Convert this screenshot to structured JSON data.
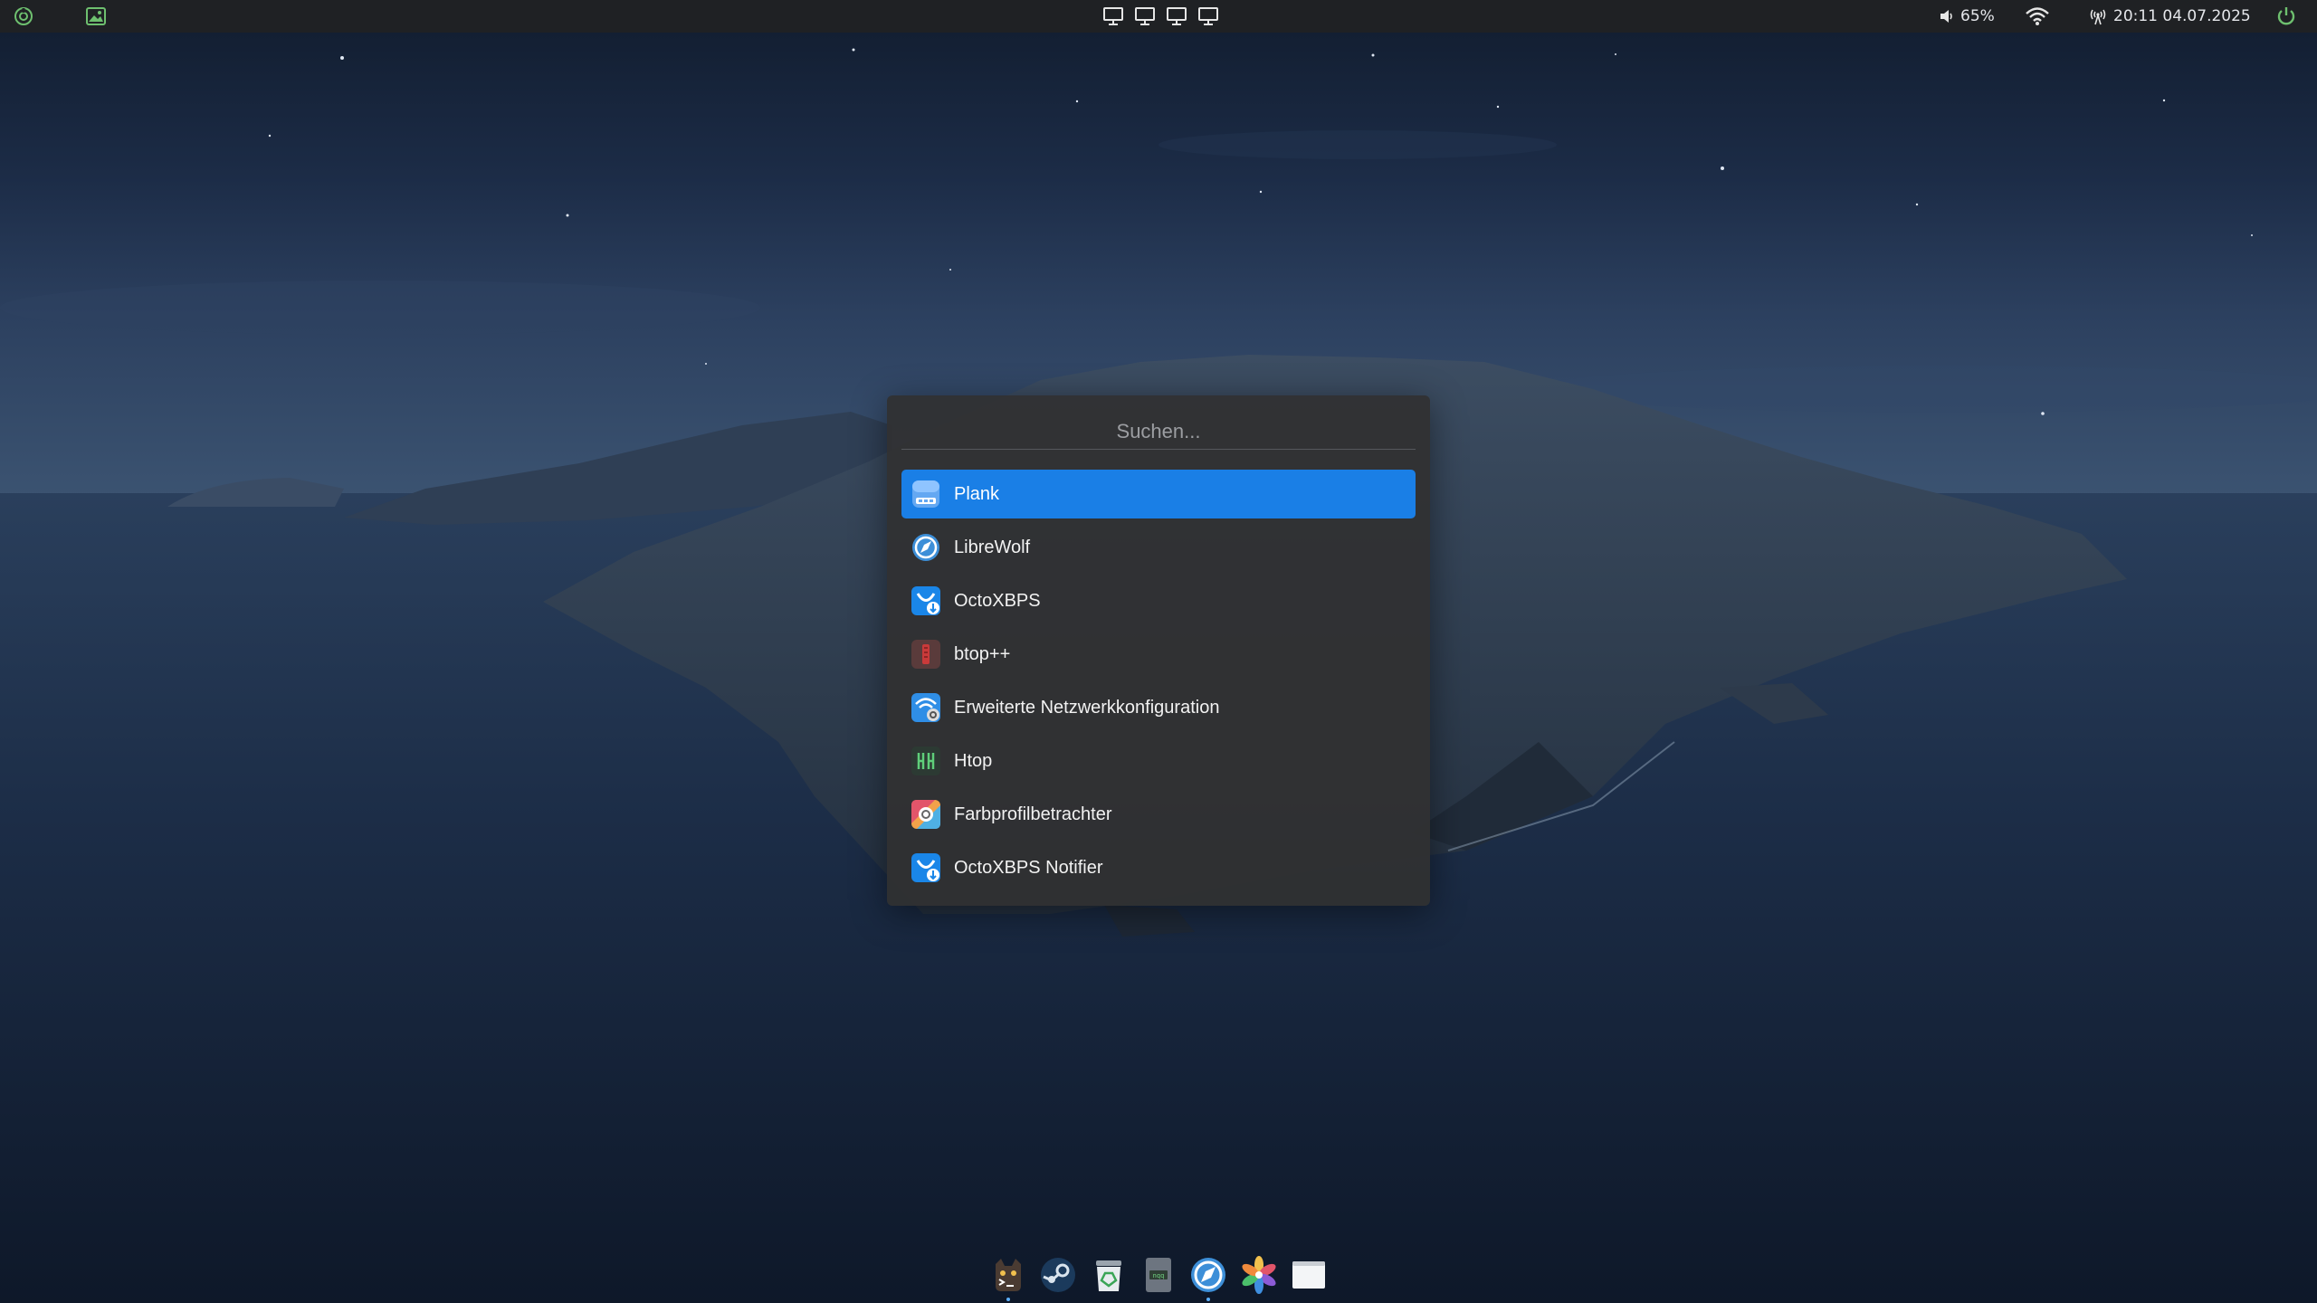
{
  "top_panel": {
    "left_icons": [
      "menu-icon",
      "image-viewer-icon"
    ],
    "workspaces": [
      "workspace-1",
      "workspace-2",
      "workspace-3",
      "workspace-4"
    ],
    "volume": {
      "icon": "volume-icon",
      "label": "65%"
    },
    "network": {
      "icon": "wifi-icon"
    },
    "clock": {
      "icon": "radio-antenna-icon",
      "label": "20:11 04.07.2025"
    },
    "power": {
      "icon": "power-icon"
    },
    "accent_color": "#6ec06f"
  },
  "launcher": {
    "search": {
      "placeholder": "Suchen...",
      "value": ""
    },
    "selected_index": 0,
    "selection_color": "#1a7fe6",
    "results": [
      {
        "label": "Plank",
        "icon": "plank-icon"
      },
      {
        "label": "LibreWolf",
        "icon": "librewolf-icon"
      },
      {
        "label": "OctoXBPS",
        "icon": "octoxbps-icon"
      },
      {
        "label": "btop++",
        "icon": "btop-icon"
      },
      {
        "label": "Erweiterte Netzwerkkonfiguration",
        "icon": "network-config-icon"
      },
      {
        "label": "Htop",
        "icon": "htop-icon"
      },
      {
        "label": "Farbprofilbetrachter",
        "icon": "color-profile-icon"
      },
      {
        "label": "OctoXBPS Notifier",
        "icon": "octoxbps-notifier-icon"
      }
    ]
  },
  "dock": {
    "items": [
      {
        "icon": "terminal-icon",
        "running": true
      },
      {
        "icon": "steam-icon",
        "running": false
      },
      {
        "icon": "trash-icon",
        "running": false
      },
      {
        "icon": "nqq-editor-icon",
        "running": false
      },
      {
        "icon": "librewolf-icon",
        "running": true
      },
      {
        "icon": "photos-icon",
        "running": false
      },
      {
        "icon": "window-icon",
        "running": false
      }
    ]
  }
}
